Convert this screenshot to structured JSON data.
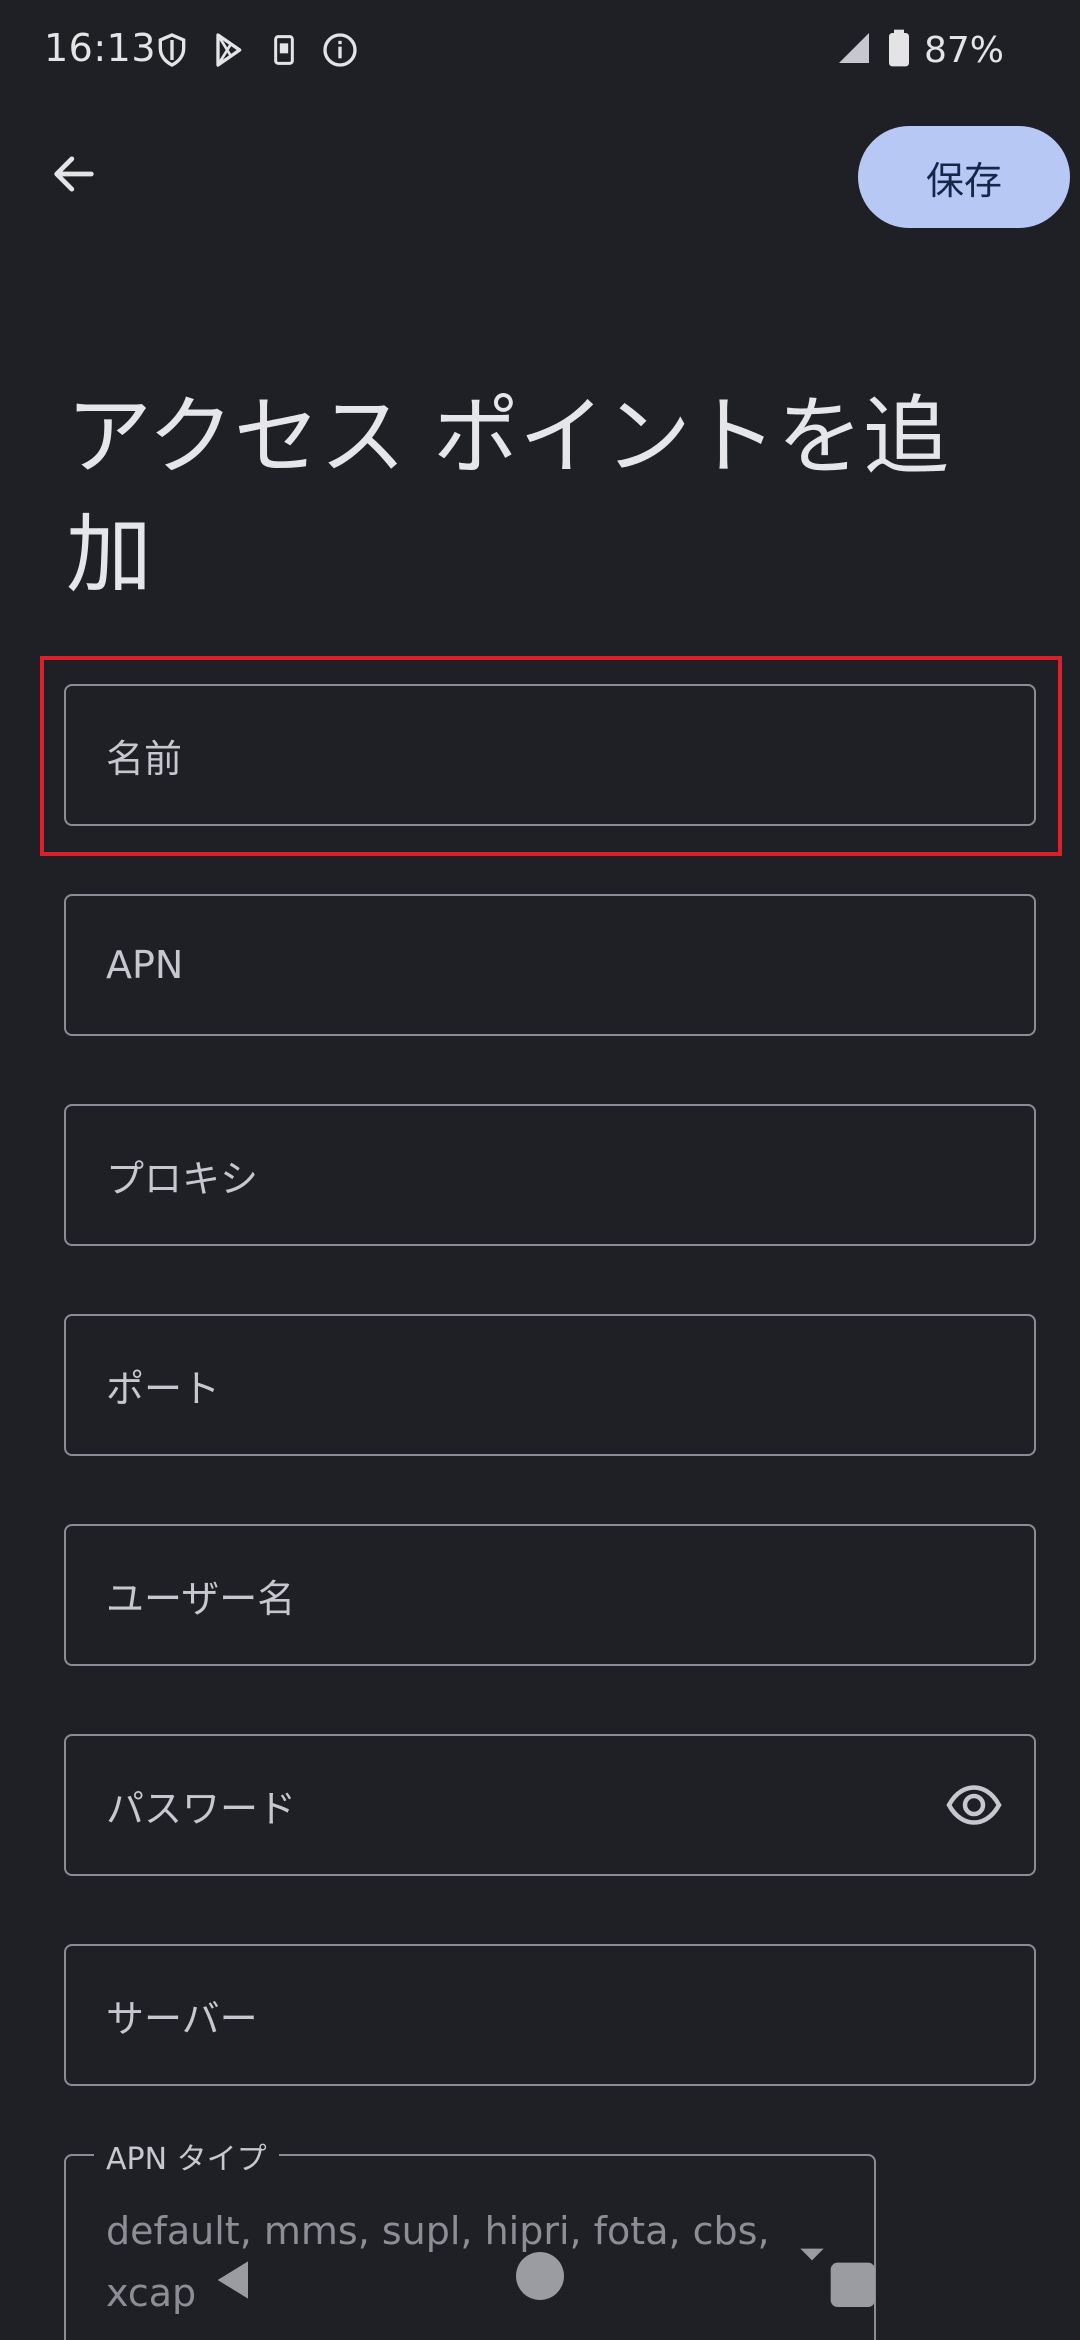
{
  "status_bar": {
    "time": "16:13",
    "icons_left": [
      "shield-icon",
      "play-store-icon",
      "sim-card-icon",
      "info-icon"
    ],
    "battery_percent": "87%"
  },
  "app_bar": {
    "back_icon": "arrow-left-icon",
    "save_label": "保存"
  },
  "page": {
    "title": "アクセス ポイントを追加"
  },
  "fields": [
    {
      "placeholder": "名前"
    },
    {
      "placeholder": "APN"
    },
    {
      "placeholder": "プロキシ"
    },
    {
      "placeholder": "ポート"
    },
    {
      "placeholder": "ユーザー名"
    },
    {
      "placeholder": "パスワード",
      "trailing_icon": "eye-icon"
    },
    {
      "placeholder": "サーバー"
    }
  ],
  "apn_type": {
    "label": "APN タイプ",
    "hint": "default, mms, supl, hipri, fota, cbs, xcap"
  },
  "colors": {
    "background": "#1f2026",
    "save_button": "#b7c8f4",
    "highlight": "#d9202b",
    "field_border": "#8b8d96"
  }
}
